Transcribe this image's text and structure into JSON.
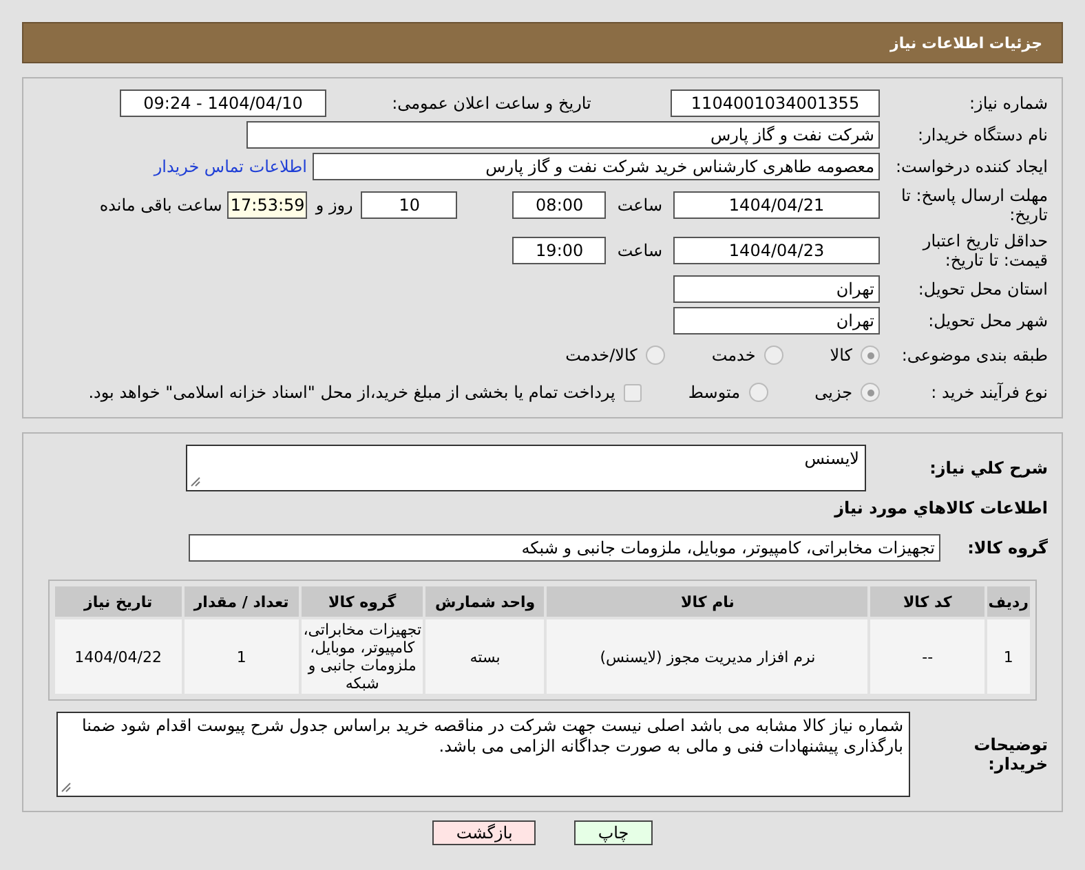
{
  "header": {
    "title": "جزئیات اطلاعات نیاز"
  },
  "need_number": {
    "label": "شماره نیاز:",
    "value": "1104001034001355"
  },
  "announce": {
    "label": "تاریخ و ساعت اعلان عمومی:",
    "value": "1404/04/10 - 09:24"
  },
  "buyer_org": {
    "label": "نام دستگاه خریدار:",
    "value": "شرکت نفت و گاز پارس"
  },
  "requester": {
    "label": "ایجاد کننده درخواست:",
    "value": "معصومه  طاهری کارشناس خرید  شرکت نفت و گاز پارس",
    "link": "اطلاعات تماس خریدار"
  },
  "deadline": {
    "label": "مهلت ارسال پاسخ: تا تاریخ:",
    "date": "1404/04/21",
    "time_label": "ساعت",
    "time": "08:00",
    "days": "10",
    "days_label": "روز و",
    "remaining": "17:53:59",
    "remaining_label": "ساعت باقی مانده"
  },
  "validity": {
    "label": "حداقل تاریخ اعتبار قیمت: تا تاریخ:",
    "date": "1404/04/23",
    "time_label": "ساعت",
    "time": "19:00"
  },
  "province": {
    "label": "استان محل تحویل:",
    "value": "تهران"
  },
  "city": {
    "label": "شهر محل تحویل:",
    "value": "تهران"
  },
  "category": {
    "label": "طبقه بندی موضوعی:",
    "options": [
      {
        "label": "کالا",
        "selected": true
      },
      {
        "label": "خدمت",
        "selected": false
      },
      {
        "label": "کالا/خدمت",
        "selected": false
      }
    ]
  },
  "process": {
    "label": "نوع فرآیند خرید :",
    "options": [
      {
        "label": "جزیی",
        "selected": true
      },
      {
        "label": "متوسط",
        "selected": false
      }
    ],
    "checkbox": {
      "label": "پرداخت تمام یا بخشی از مبلغ خرید،از محل \"اسناد خزانه اسلامی\" خواهد بود.",
      "checked": false
    }
  },
  "description": {
    "label": "شرح کلي نياز:",
    "value": "لایسنس"
  },
  "goods_title": "اطلاعات کالاهاي مورد نياز",
  "goods_group": {
    "label": "گروه کالا:",
    "value": "تجهیزات مخابراتی، کامپیوتر، موبایل، ملزومات جانبی و شبکه"
  },
  "table": {
    "columns": [
      "ردیف",
      "کد کالا",
      "نام کالا",
      "واحد شمارش",
      "گروه کالا",
      "تعداد / مقدار",
      "تاریخ نیاز"
    ],
    "rows": [
      [
        "1",
        "--",
        "نرم افزار مدیریت مجوز (لایسنس)",
        "بسته",
        "تجهیزات مخابراتی، کامپیوتر، موبایل، ملزومات جانبی و شبکه",
        "1",
        "1404/04/22"
      ]
    ]
  },
  "buyer_notes": {
    "label": "توضیحات خریدار:",
    "value": "شماره نیاز کالا مشابه می باشد اصلی نیست جهت شرکت در مناقصه خرید براساس جدول شرح پیوست اقدام شود ضمنا بارگذاری پیشنهادات فنی و مالی به صورت جداگانه الزامی می باشد."
  },
  "buttons": [
    {
      "label": "چاپ",
      "kind": "print"
    },
    {
      "label": "بازگشت",
      "kind": "back"
    }
  ]
}
